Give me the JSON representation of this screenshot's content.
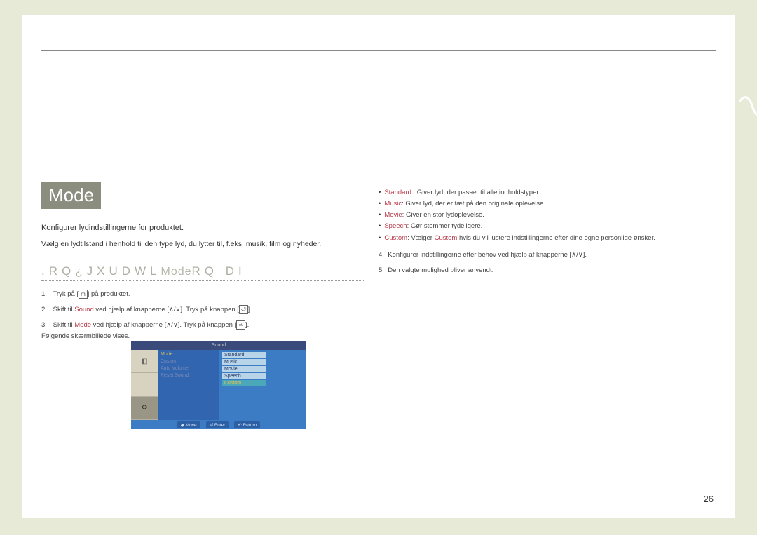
{
  "title": "Mode",
  "intro1": "Konfigurer lydindstillingerne for produktet.",
  "intro2": "Vælg en lydtilstand i henhold til den type lyd, du lytter til, f.eks. musik, film og nyheder.",
  "subheading_pre": ".RQ¿JXUDWL",
  "subheading_mode": "Mode",
  "subheading_post": "RQ  DI",
  "step1_a": "Tryk på [",
  "step1_b": "] på produktet.",
  "step2_a": "Skift til ",
  "step2_sound": "Sound",
  "step2_b": " ved hjælp af knapperne [",
  "step2_c": "]. Tryk på knappen [",
  "step2_d": "].",
  "step3_a": "Skift til ",
  "step3_mode": "Mode",
  "step3_b": " ved hjælp af knapperne [",
  "step3_c": "]. Tryk på knappen [",
  "step3_d": "].",
  "step3_e": "Følgende skærmbillede vises.",
  "scr_title": "Sound",
  "scr_gear": "⚙",
  "scr_menu": {
    "mode": "Mode",
    "custom": "Custom",
    "autovolume": "Auto Volume",
    "reset": "Reset Sound"
  },
  "scr_opts": {
    "standard": "Standard",
    "music": "Music",
    "movie": "Movie",
    "speech": "Speech",
    "custom": "Custom"
  },
  "scr_nav": {
    "move": "◆ Move",
    "enter": "⏎ Enter",
    "return": "↶ Return"
  },
  "bullets": {
    "standard_l": "Standard",
    "standard_t": " : Giver lyd, der passer til alle indholdstyper.",
    "music_l": "Music",
    "music_t": ": Giver lyd, der er tæt på den originale oplevelse.",
    "movie_l": "Movie",
    "movie_t": ": Giver en stor lydoplevelse.",
    "speech_l": "Speech",
    "speech_t": ": Gør stemmer tydeligere.",
    "custom_l": "Custom",
    "custom_t1": ": Vælger ",
    "custom_l2": "Custom",
    "custom_t2": " hvis du vil justere indstillingerne efter dine egne personlige ønsker."
  },
  "step4": "Konfigurer indstillingerne efter behov ved hjælp af knapperne [∧/∨].",
  "step5": "Den valgte mulighed bliver anvendt.",
  "pagenum": "26"
}
